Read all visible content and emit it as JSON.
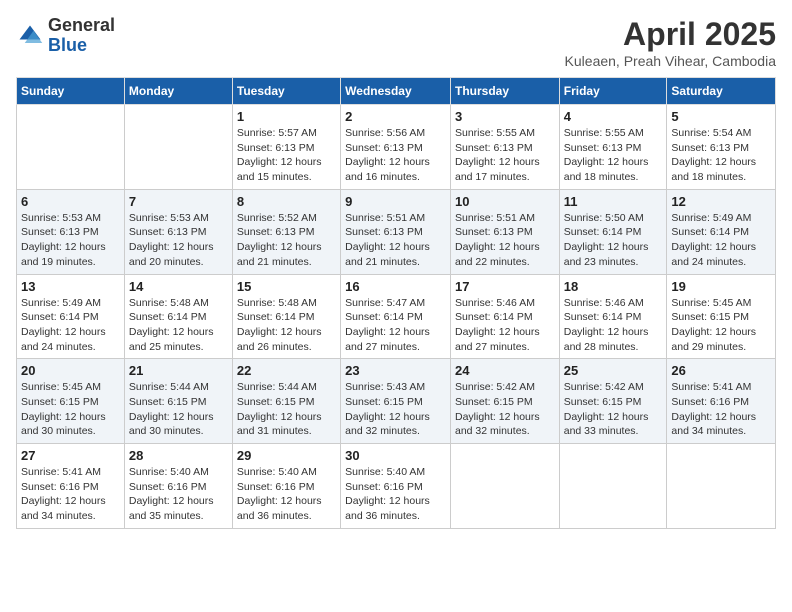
{
  "logo": {
    "general": "General",
    "blue": "Blue"
  },
  "title": "April 2025",
  "subtitle": "Kuleaen, Preah Vihear, Cambodia",
  "days_of_week": [
    "Sunday",
    "Monday",
    "Tuesday",
    "Wednesday",
    "Thursday",
    "Friday",
    "Saturday"
  ],
  "weeks": [
    [
      {
        "day": "",
        "sunrise": "",
        "sunset": "",
        "daylight": ""
      },
      {
        "day": "",
        "sunrise": "",
        "sunset": "",
        "daylight": ""
      },
      {
        "day": "1",
        "sunrise": "Sunrise: 5:57 AM",
        "sunset": "Sunset: 6:13 PM",
        "daylight": "Daylight: 12 hours and 15 minutes."
      },
      {
        "day": "2",
        "sunrise": "Sunrise: 5:56 AM",
        "sunset": "Sunset: 6:13 PM",
        "daylight": "Daylight: 12 hours and 16 minutes."
      },
      {
        "day": "3",
        "sunrise": "Sunrise: 5:55 AM",
        "sunset": "Sunset: 6:13 PM",
        "daylight": "Daylight: 12 hours and 17 minutes."
      },
      {
        "day": "4",
        "sunrise": "Sunrise: 5:55 AM",
        "sunset": "Sunset: 6:13 PM",
        "daylight": "Daylight: 12 hours and 18 minutes."
      },
      {
        "day": "5",
        "sunrise": "Sunrise: 5:54 AM",
        "sunset": "Sunset: 6:13 PM",
        "daylight": "Daylight: 12 hours and 18 minutes."
      }
    ],
    [
      {
        "day": "6",
        "sunrise": "Sunrise: 5:53 AM",
        "sunset": "Sunset: 6:13 PM",
        "daylight": "Daylight: 12 hours and 19 minutes."
      },
      {
        "day": "7",
        "sunrise": "Sunrise: 5:53 AM",
        "sunset": "Sunset: 6:13 PM",
        "daylight": "Daylight: 12 hours and 20 minutes."
      },
      {
        "day": "8",
        "sunrise": "Sunrise: 5:52 AM",
        "sunset": "Sunset: 6:13 PM",
        "daylight": "Daylight: 12 hours and 21 minutes."
      },
      {
        "day": "9",
        "sunrise": "Sunrise: 5:51 AM",
        "sunset": "Sunset: 6:13 PM",
        "daylight": "Daylight: 12 hours and 21 minutes."
      },
      {
        "day": "10",
        "sunrise": "Sunrise: 5:51 AM",
        "sunset": "Sunset: 6:13 PM",
        "daylight": "Daylight: 12 hours and 22 minutes."
      },
      {
        "day": "11",
        "sunrise": "Sunrise: 5:50 AM",
        "sunset": "Sunset: 6:14 PM",
        "daylight": "Daylight: 12 hours and 23 minutes."
      },
      {
        "day": "12",
        "sunrise": "Sunrise: 5:49 AM",
        "sunset": "Sunset: 6:14 PM",
        "daylight": "Daylight: 12 hours and 24 minutes."
      }
    ],
    [
      {
        "day": "13",
        "sunrise": "Sunrise: 5:49 AM",
        "sunset": "Sunset: 6:14 PM",
        "daylight": "Daylight: 12 hours and 24 minutes."
      },
      {
        "day": "14",
        "sunrise": "Sunrise: 5:48 AM",
        "sunset": "Sunset: 6:14 PM",
        "daylight": "Daylight: 12 hours and 25 minutes."
      },
      {
        "day": "15",
        "sunrise": "Sunrise: 5:48 AM",
        "sunset": "Sunset: 6:14 PM",
        "daylight": "Daylight: 12 hours and 26 minutes."
      },
      {
        "day": "16",
        "sunrise": "Sunrise: 5:47 AM",
        "sunset": "Sunset: 6:14 PM",
        "daylight": "Daylight: 12 hours and 27 minutes."
      },
      {
        "day": "17",
        "sunrise": "Sunrise: 5:46 AM",
        "sunset": "Sunset: 6:14 PM",
        "daylight": "Daylight: 12 hours and 27 minutes."
      },
      {
        "day": "18",
        "sunrise": "Sunrise: 5:46 AM",
        "sunset": "Sunset: 6:14 PM",
        "daylight": "Daylight: 12 hours and 28 minutes."
      },
      {
        "day": "19",
        "sunrise": "Sunrise: 5:45 AM",
        "sunset": "Sunset: 6:15 PM",
        "daylight": "Daylight: 12 hours and 29 minutes."
      }
    ],
    [
      {
        "day": "20",
        "sunrise": "Sunrise: 5:45 AM",
        "sunset": "Sunset: 6:15 PM",
        "daylight": "Daylight: 12 hours and 30 minutes."
      },
      {
        "day": "21",
        "sunrise": "Sunrise: 5:44 AM",
        "sunset": "Sunset: 6:15 PM",
        "daylight": "Daylight: 12 hours and 30 minutes."
      },
      {
        "day": "22",
        "sunrise": "Sunrise: 5:44 AM",
        "sunset": "Sunset: 6:15 PM",
        "daylight": "Daylight: 12 hours and 31 minutes."
      },
      {
        "day": "23",
        "sunrise": "Sunrise: 5:43 AM",
        "sunset": "Sunset: 6:15 PM",
        "daylight": "Daylight: 12 hours and 32 minutes."
      },
      {
        "day": "24",
        "sunrise": "Sunrise: 5:42 AM",
        "sunset": "Sunset: 6:15 PM",
        "daylight": "Daylight: 12 hours and 32 minutes."
      },
      {
        "day": "25",
        "sunrise": "Sunrise: 5:42 AM",
        "sunset": "Sunset: 6:15 PM",
        "daylight": "Daylight: 12 hours and 33 minutes."
      },
      {
        "day": "26",
        "sunrise": "Sunrise: 5:41 AM",
        "sunset": "Sunset: 6:16 PM",
        "daylight": "Daylight: 12 hours and 34 minutes."
      }
    ],
    [
      {
        "day": "27",
        "sunrise": "Sunrise: 5:41 AM",
        "sunset": "Sunset: 6:16 PM",
        "daylight": "Daylight: 12 hours and 34 minutes."
      },
      {
        "day": "28",
        "sunrise": "Sunrise: 5:40 AM",
        "sunset": "Sunset: 6:16 PM",
        "daylight": "Daylight: 12 hours and 35 minutes."
      },
      {
        "day": "29",
        "sunrise": "Sunrise: 5:40 AM",
        "sunset": "Sunset: 6:16 PM",
        "daylight": "Daylight: 12 hours and 36 minutes."
      },
      {
        "day": "30",
        "sunrise": "Sunrise: 5:40 AM",
        "sunset": "Sunset: 6:16 PM",
        "daylight": "Daylight: 12 hours and 36 minutes."
      },
      {
        "day": "",
        "sunrise": "",
        "sunset": "",
        "daylight": ""
      },
      {
        "day": "",
        "sunrise": "",
        "sunset": "",
        "daylight": ""
      },
      {
        "day": "",
        "sunrise": "",
        "sunset": "",
        "daylight": ""
      }
    ]
  ]
}
